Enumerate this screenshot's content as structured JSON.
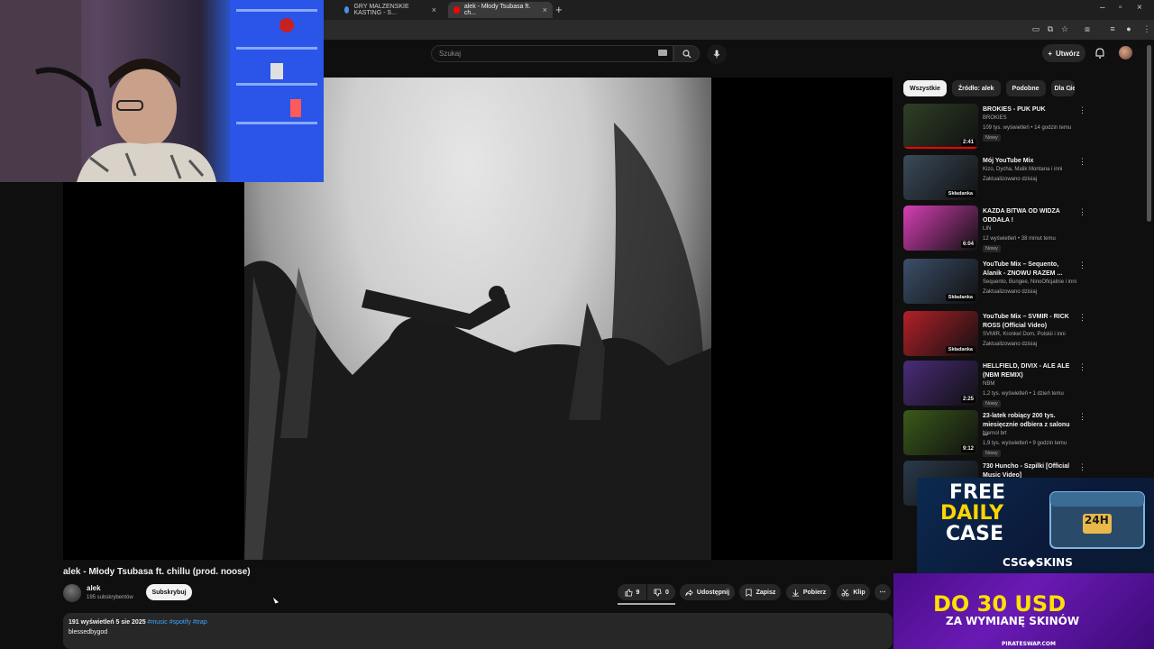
{
  "browser": {
    "tabs": [
      {
        "label": "GRY MALZENSKIE KASTING - S..."
      },
      {
        "label": "alek - Młody Tsubasa ft. ch..."
      }
    ]
  },
  "header": {
    "search_placeholder": "Szukaj",
    "create_label": "Utwórz"
  },
  "video": {
    "title": "alek - Młody Tsubasa ft. chillu (prod. noose)",
    "channel": "alek",
    "subscribers": "195 subskrybentów",
    "subscribe_label": "Subskrybuj",
    "likes": "9",
    "dislikes": "0",
    "actions": {
      "share": "Udostępnij",
      "save": "Zapisz",
      "download": "Pobierz",
      "clip": "Klip",
      "more": "⋯"
    }
  },
  "description": {
    "meta": "191 wyświetleń  5 sie 2025",
    "tags": "#music #spotify #trap",
    "line1": "blessedbygod"
  },
  "sidebar": {
    "chips": [
      "Wszystkie",
      "Źródło: alek",
      "Podobne",
      "Dla Cie"
    ],
    "recommendations": [
      {
        "title": "BROKIES - PUK PUK",
        "channel": "BROKIES",
        "meta": "109 tys. wyświetleń • 14 godzin temu",
        "badge": "Nowy",
        "duration": "2:41",
        "thumb_color": "#2f4026"
      },
      {
        "title": "Mój YouTube Mix",
        "channel": "Kizo, Dycha, Malik Montana i inni",
        "meta": "Zaktualizowano dzisiaj",
        "badge": "",
        "duration": "Składanka",
        "thumb_color": "#3a4a5a"
      },
      {
        "title": "KAZDA BITWA OD WIDZA ODDAŁA !",
        "channel": "LIN",
        "meta": "12 wyświetleń • 38 minut temu",
        "badge": "Nowy",
        "duration": "6:04",
        "thumb_color": "#d63fb5"
      },
      {
        "title": "YouTube Mix – Sequento, Alanik - ZNOWU RAZEM ...",
        "channel": "Sequento, Bungee, NinoOficjalnie i inni",
        "meta": "Zaktualizowano dzisiaj",
        "badge": "",
        "duration": "Składanka",
        "thumb_color": "#3b4f6a"
      },
      {
        "title": "YouTube Mix – SVMIR - RICK ROSS (Official Video)",
        "channel": "SVMIR, Kronkel Dom, Polskii i inni",
        "meta": "Zaktualizowano dzisiaj",
        "badge": "",
        "duration": "Składanka",
        "thumb_color": "#b3202a"
      },
      {
        "title": "HELLFIELD, DIVIX - ALE ALE (NBM REMIX)",
        "channel": "NBM",
        "meta": "1,2 tys. wyświetleń • 1 dzień temu",
        "badge": "Nowy",
        "duration": "2:25",
        "thumb_color": "#4a2c7a"
      },
      {
        "title": "23-latek robiący 200 tys. miesięcznie odbiera z salonu ...",
        "channel": "biernol brt",
        "meta": "1,9 tys. wyświetleń • 9 godzin temu",
        "badge": "Nowy",
        "duration": "9:12",
        "thumb_color": "#3a5a1a"
      },
      {
        "title": "730 Huncho - Szpilki [Official Music Video]",
        "channel": "",
        "meta": "",
        "badge": "",
        "duration": "",
        "thumb_color": "#2a3a4a"
      }
    ]
  },
  "ads": {
    "top": {
      "line1": "FREE",
      "line2": "DAILY",
      "line3": "CASE",
      "brand": "CSG◆SKINS",
      "badge": "24H"
    },
    "bottom": {
      "headline": "DO 30 USD",
      "sub": "ZA WYMIANĘ SKINÓW",
      "brand": "PIRATESWAP.COM"
    }
  }
}
